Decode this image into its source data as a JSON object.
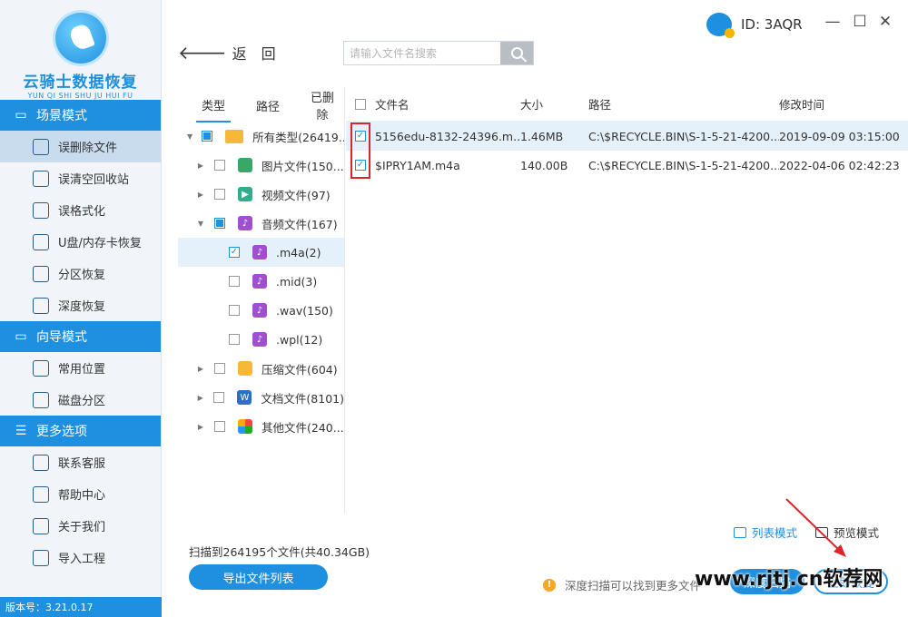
{
  "app": {
    "logo_title": "云骑士数据恢复",
    "logo_subtitle": "YUN QI SHI SHU JU HUI FU",
    "user_id": "ID: 3AQR",
    "version": "版本号：3.21.0.17"
  },
  "window_controls": {
    "minimize": "—",
    "maximize": "☐",
    "close": "✕"
  },
  "sidebar": {
    "sections": [
      {
        "title": "场景模式",
        "icon": "scene-icon",
        "items": [
          {
            "label": "误删除文件",
            "icon": "deleted-file-icon",
            "active": true
          },
          {
            "label": "误清空回收站",
            "icon": "recycle-bin-icon"
          },
          {
            "label": "误格式化",
            "icon": "format-icon"
          },
          {
            "label": "U盘/内存卡恢复",
            "icon": "usb-drive-icon"
          },
          {
            "label": "分区恢复",
            "icon": "partition-icon"
          },
          {
            "label": "深度恢复",
            "icon": "deep-recover-icon"
          }
        ]
      },
      {
        "title": "向导模式",
        "icon": "guide-icon",
        "items": [
          {
            "label": "常用位置",
            "icon": "common-location-icon"
          },
          {
            "label": "磁盘分区",
            "icon": "disk-partition-icon"
          }
        ]
      },
      {
        "title": "更多选项",
        "icon": "menu-icon",
        "items": [
          {
            "label": "联系客服",
            "icon": "phone-icon"
          },
          {
            "label": "帮助中心",
            "icon": "help-icon"
          },
          {
            "label": "关于我们",
            "icon": "info-icon"
          },
          {
            "label": "导入工程",
            "icon": "import-icon"
          }
        ]
      }
    ]
  },
  "toolbar": {
    "back_label": "返　回",
    "search_placeholder": "请输入文件名搜索"
  },
  "tree": {
    "tabs": [
      "类型",
      "路径",
      "已删除"
    ],
    "rows": [
      {
        "label": "所有类型(26419...",
        "caret": "▼",
        "check": "partial",
        "icon": "folder-icon",
        "indent": 0
      },
      {
        "label": "图片文件(150...",
        "caret": "▶",
        "check": "none",
        "icon": "image-icon",
        "indent": 1
      },
      {
        "label": "视频文件(97)",
        "caret": "▶",
        "check": "none",
        "icon": "video-icon",
        "indent": 1
      },
      {
        "label": "音频文件(167)",
        "caret": "▼",
        "check": "partial",
        "icon": "audio-icon",
        "indent": 1
      },
      {
        "label": ".m4a(2)",
        "caret": "",
        "check": "checked",
        "icon": "audio-icon",
        "indent": 2,
        "selected": true
      },
      {
        "label": ".mid(3)",
        "caret": "",
        "check": "none",
        "icon": "audio-icon",
        "indent": 2
      },
      {
        "label": ".wav(150)",
        "caret": "",
        "check": "none",
        "icon": "audio-icon",
        "indent": 2
      },
      {
        "label": ".wpl(12)",
        "caret": "",
        "check": "none",
        "icon": "audio-icon",
        "indent": 2
      },
      {
        "label": "压缩文件(604)",
        "caret": "▶",
        "check": "none",
        "icon": "zip-icon",
        "indent": 1
      },
      {
        "label": "文档文件(8101)",
        "caret": "▶",
        "check": "none",
        "icon": "document-icon",
        "indent": 1
      },
      {
        "label": "其他文件(240...",
        "caret": "▶",
        "check": "none",
        "icon": "other-files-icon",
        "indent": 1
      }
    ]
  },
  "file_list": {
    "columns": {
      "name": "文件名",
      "size": "大小",
      "path": "路径",
      "time": "修改时间"
    },
    "rows": [
      {
        "name": "5156edu-8132-24396.m...",
        "size": "1.46MB",
        "path": "C:\\$RECYCLE.BIN\\S-1-5-21-4200...",
        "time": "2019-09-09 03:15:00",
        "checked": true,
        "highlight": true
      },
      {
        "name": "$IPRY1AM.m4a",
        "size": "140.00B",
        "path": "C:\\$RECYCLE.BIN\\S-1-5-21-4200...",
        "time": "2022-04-06 02:42:23",
        "checked": true,
        "highlight": false
      }
    ]
  },
  "view_modes": {
    "list": "列表模式",
    "preview": "预览模式"
  },
  "footer": {
    "scan_info": "扫描到264195个文件(共40.34GB)",
    "export_label": "导出文件列表",
    "tip": "深度扫描可以找到更多文件",
    "deep_scan_label": "深度扫描",
    "recover_label": "立即恢复",
    "watermark": "www.rjtj.cn软荐网"
  },
  "colors": {
    "accent": "#1f8fe0",
    "highlight_box": "#d9262a",
    "selected_row": "#e4f1fb"
  }
}
